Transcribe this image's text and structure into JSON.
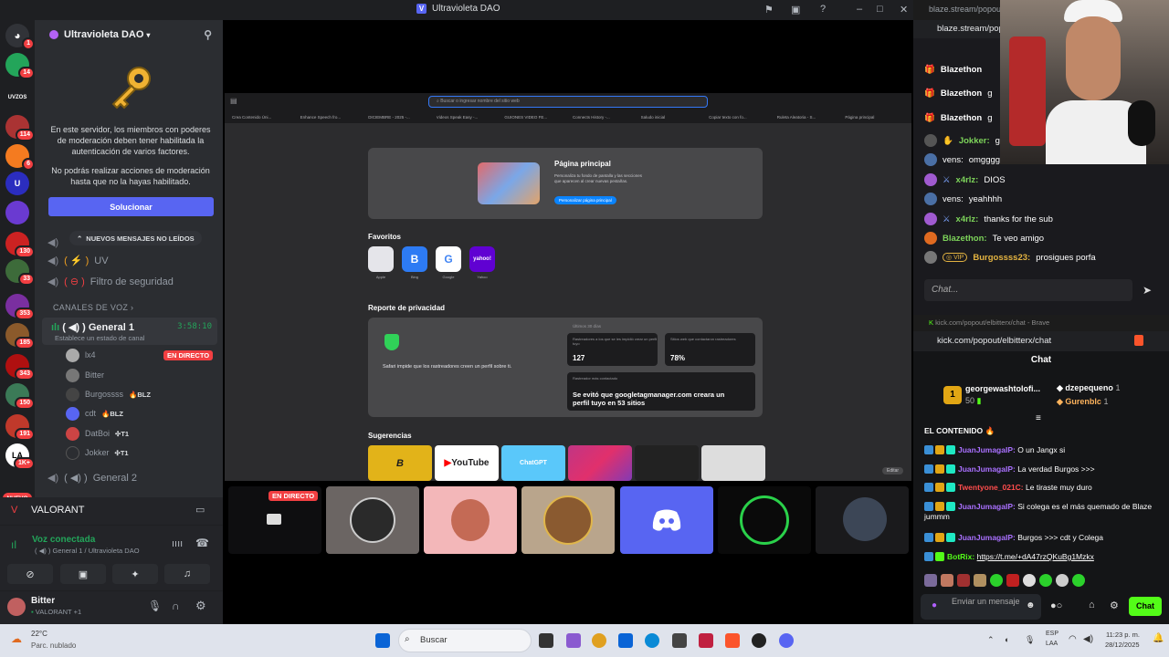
{
  "window": {
    "title": "Ultravioleta DAO"
  },
  "rail": {
    "badges": [
      "1",
      "14",
      "114",
      "6",
      "130",
      "33",
      "353",
      "185",
      "343",
      "150",
      "191",
      "1K+",
      "1K+"
    ],
    "new_label": "NUEVO",
    "uvzone_label": "UVZOS"
  },
  "sidebar": {
    "server_name": "Ultravioleta DAO",
    "notice_1": "En este servidor, los miembros con poderes de moderación deben tener habilitada la autenticación de varios factores.",
    "notice_2": "No podrás realizar acciones de moderación hasta que no la hayas habilitado.",
    "fix_button": "Solucionar",
    "unread_pill": "NUEVOS MENSAJES NO LEÍDOS",
    "channels": [
      {
        "name": "UV"
      },
      {
        "name": "Filtro de seguridad"
      }
    ],
    "voice_category": "CANALES DE VOZ",
    "voice_channel": {
      "name": "General 1",
      "timer": "3:58:10",
      "status": "Establece un estado de canal"
    },
    "voice_users": [
      {
        "name": "lx4",
        "badge": ""
      },
      {
        "name": "Bitter",
        "badge": ""
      },
      {
        "name": "Burgossss",
        "badge": "BLZ"
      },
      {
        "name": "cdt",
        "badge": "BLZ"
      },
      {
        "name": "DatBoi",
        "badge": "T1"
      },
      {
        "name": "Jokker",
        "badge": "T1"
      }
    ],
    "live_badge": "EN DIRECTO",
    "voice_channel_2": "General 2"
  },
  "activity": {
    "name": "VALORANT"
  },
  "voice_panel": {
    "status": "Voz conectada",
    "location": "General 1 / Ultravioleta DAO"
  },
  "user_panel": {
    "name": "Bitter",
    "activity": "VALORANT +1"
  },
  "browser": {
    "search_placeholder": "Buscar o ingresar nombre del sitio web",
    "tabs": [
      "Crea Contenido Úni...",
      "Enhance Speech fro...",
      "DICIEMBRE - 2025 -...",
      "Videos Speak Easy -...",
      "GUIONES VIDEO FE...",
      "Connects History -...",
      "Saludo inicial",
      "Copiar texto con fo...",
      "Ruleta Aleatoria - S...",
      "Página principal"
    ],
    "hero_title": "Página principal",
    "hero_text": "Personaliza tu fondo de pantalla y las secciones que aparecen al crear nuevas pestañas.",
    "hero_button": "Personalizar página principal",
    "favorites_title": "Favoritos",
    "favorites": [
      {
        "label": "Apple",
        "glyph": "",
        "color": "#e5e5ea"
      },
      {
        "label": "Bing",
        "glyph": "B",
        "color": "#2d7bf4"
      },
      {
        "label": "Google",
        "glyph": "G",
        "color": "#ffffff"
      },
      {
        "label": "Yahoo",
        "glyph": "yahoo!",
        "color": "#6001d2"
      }
    ],
    "privacy_title": "Reporte de privacidad",
    "privacy_range": "Últimos 30 días",
    "privacy_text": "Safari impide que los rastreadores creen un perfil sobre ti.",
    "stat_1_label": "Rastreadores a los que se les impidió crear un perfil tuyo",
    "stat_1_value": "127",
    "stat_2_label": "Sitios web que contactaron rastreadores",
    "stat_2_value": "78%",
    "stat_3_label": "Rastreador más contactado",
    "stat_3_value": "Se evitó que googletagmanager.com creara un perfil tuyo en 53 sitios",
    "suggestions_title": "Sugerencias",
    "suggestions": [
      "B",
      "YouTube",
      "ChatGPT",
      "",
      "",
      ""
    ],
    "edit_button": "Editar"
  },
  "stage": {
    "live_badge": "EN DIRECTO"
  },
  "blaze": {
    "tab_url": "blaze.stream/popout",
    "url": "blaze.stream/pop",
    "messages": [
      {
        "user": "Blazethon",
        "text": "",
        "color": "#ffffff"
      },
      {
        "user": "Blazethon",
        "text": "g",
        "color": "#ffffff"
      },
      {
        "user": "Blazethon",
        "text": "g",
        "color": "#ffffff"
      },
      {
        "user": "Jokker:",
        "text": "g",
        "color": "#7dd45a"
      },
      {
        "user": "vens:",
        "text": "omgggggg",
        "color": "#ffffff"
      },
      {
        "user": "x4rlz:",
        "text": "DIOS",
        "color": "#7dd45a"
      },
      {
        "user": "vens:",
        "text": "yeahhhh",
        "color": "#ffffff"
      },
      {
        "user": "x4rlz:",
        "text": "thanks for the sub",
        "color": "#7dd45a"
      },
      {
        "user": "Blazethon:",
        "text": "Te veo amigo",
        "color": "#7dd45a"
      },
      {
        "user": "Burgossss23:",
        "text": "prosigues porfa",
        "color": "#e3b341"
      }
    ],
    "vip": "VIP",
    "chat_placeholder": "Chat..."
  },
  "kick": {
    "tab_url": "kick.com/popout/elbitterx/chat - Brave",
    "url": "kick.com/popout/elbitterx/chat",
    "chat_title": "Chat",
    "top_user": "georgewashtolofi...",
    "top_count": "50",
    "leaders": [
      {
        "name": "dzepequeno",
        "count": "1"
      },
      {
        "name": "Gurenblc",
        "count": "1"
      }
    ],
    "pinned": "EL CONTENIDO",
    "messages": [
      {
        "user": "JuanJumagaIP:",
        "text": "O un Jangx si",
        "cls": "b"
      },
      {
        "user": "JuanJumagaIP:",
        "text": "La verdad Burgos >>>",
        "cls": "b"
      },
      {
        "user": "Twentyone_021C:",
        "text": "Le tiraste muy duro",
        "cls": "r"
      },
      {
        "user": "JuanJumagaIP:",
        "text": "Si colega es el más quemado de Blaze jummm",
        "cls": "b"
      },
      {
        "user": "JuanJumagaIP:",
        "text": "Burgos >>> cdt y Colega",
        "cls": "b"
      },
      {
        "user": "BotRix:",
        "text": "https://t.me/+dA47rzQKuBg1Mzkx",
        "cls": "b"
      }
    ],
    "input_placeholder": "Enviar un mensaje",
    "send_button": "Chat"
  },
  "taskbar": {
    "weather_temp": "22°C",
    "weather_desc": "Parc. nublado",
    "search": "Buscar",
    "lang_1": "ESP",
    "lang_2": "LAA",
    "time": "11:23 p. m.",
    "date": "28/12/2025"
  },
  "colors": {
    "discord_blurple": "#5865f2",
    "live_red": "#f23f42",
    "kick_green": "#53fc18",
    "voice_green": "#23a55a"
  }
}
